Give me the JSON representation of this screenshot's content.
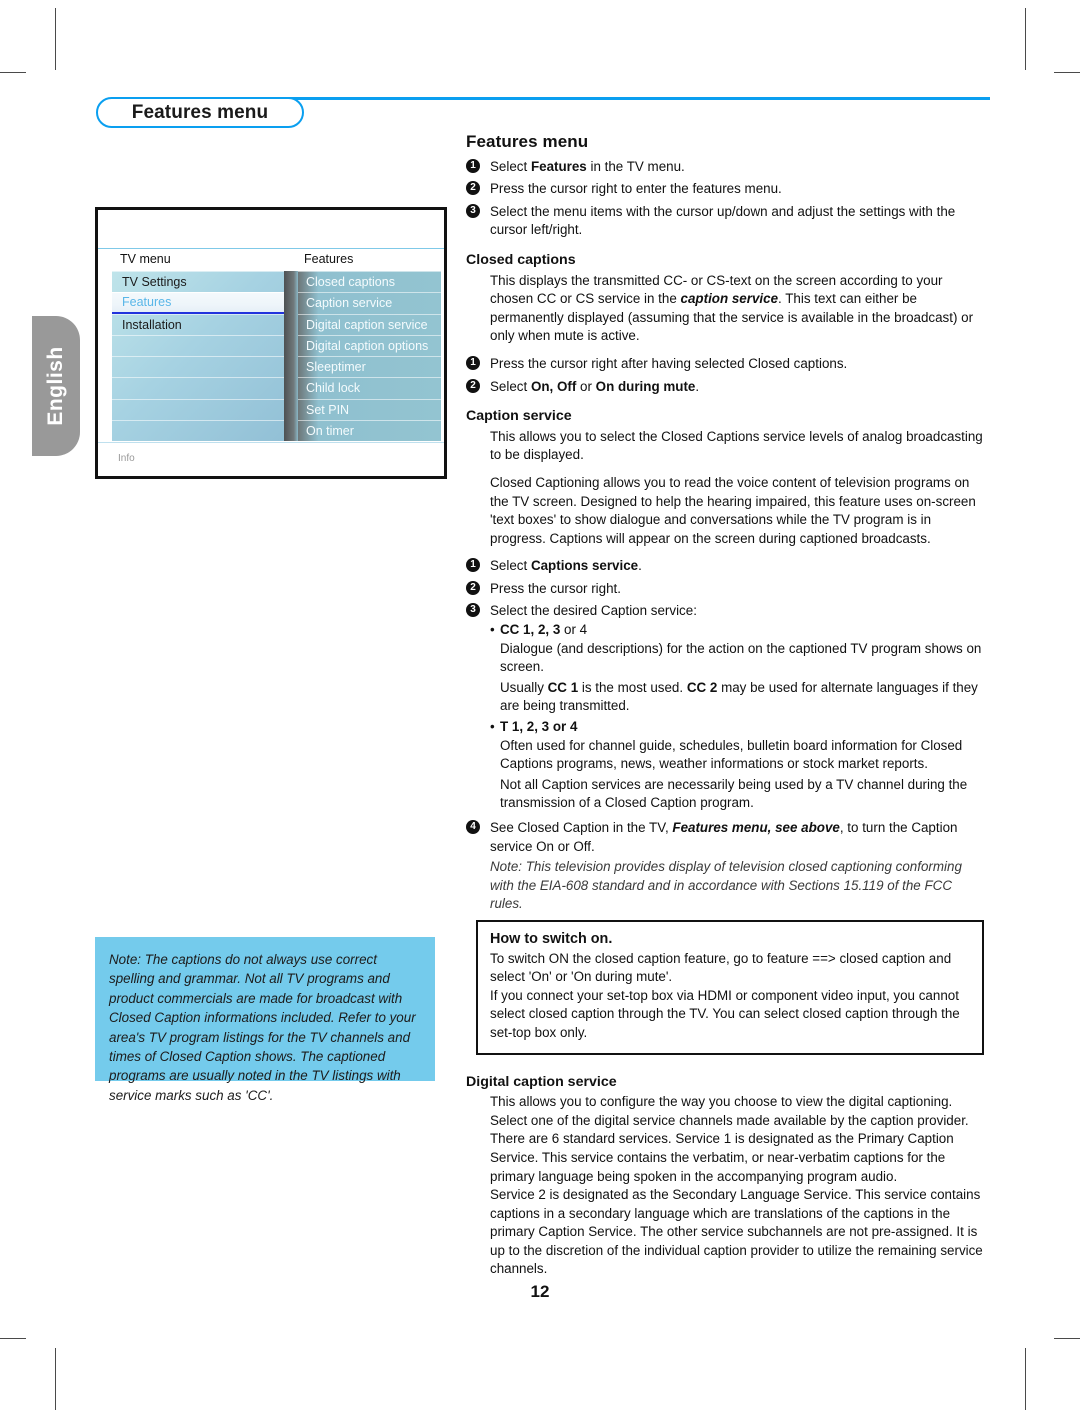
{
  "page": {
    "number": "12",
    "language_tab": "English",
    "header_badge": "Features menu"
  },
  "figure": {
    "col_head_left": "TV menu",
    "col_head_right": "Features",
    "info_label": "Info",
    "left_items": [
      {
        "label": "TV Settings",
        "selected": false
      },
      {
        "label": "Features",
        "selected": true
      },
      {
        "label": "Installation",
        "selected": false
      },
      {
        "label": "",
        "selected": false
      },
      {
        "label": "",
        "selected": false
      },
      {
        "label": "",
        "selected": false
      },
      {
        "label": "",
        "selected": false
      },
      {
        "label": "",
        "selected": false
      }
    ],
    "right_items": [
      {
        "label": "Closed captions"
      },
      {
        "label": "Caption service"
      },
      {
        "label": "Digital caption service"
      },
      {
        "label": "Digital caption options"
      },
      {
        "label": "Sleeptimer"
      },
      {
        "label": "Child lock"
      },
      {
        "label": "Set PIN"
      },
      {
        "label": "On timer"
      }
    ]
  },
  "note_box": {
    "text": "Note: The captions do not always use correct spelling and grammar. Not all TV programs and product commercials are made for broadcast with Closed Caption informations included. Refer to your area's TV program listings for the TV channels and times of Closed Caption shows. The captioned programs are usually noted in the TV listings with service marks such as 'CC'."
  },
  "content": {
    "section_title": "Features menu",
    "steps_intro": [
      {
        "num": "1",
        "text_parts": [
          "Select ",
          "Features",
          " in the TV menu."
        ]
      },
      {
        "num": "2",
        "text_parts": [
          "Press the cursor right to enter the features menu.",
          "",
          ""
        ]
      },
      {
        "num": "3",
        "text_parts": [
          "Select the menu items with the cursor up/down and adjust the settings with the cursor left/right.",
          "",
          ""
        ]
      }
    ],
    "step1_pre": "Select ",
    "step1_bold": "Features",
    "step1_post": " in the TV menu.",
    "step2": "Press the cursor right to enter the features menu.",
    "step3": "Select the menu items with the cursor up/down and adjust the settings with the cursor left/right.",
    "closed_captions": {
      "title": "Closed captions",
      "body_pre": "This displays the transmitted CC- or CS-text on the screen according to your chosen CC or CS service in the ",
      "body_bolditalic": "caption service",
      "body_post": ". This text can either be permanently displayed (assuming that the service is available in the broadcast) or only when mute is active.",
      "step1": "Press the cursor right after having selected Closed captions.",
      "step2_pre": "Select ",
      "step2_bold_a": "On, Off",
      "step2_mid": " or ",
      "step2_bold_b": "On during mute",
      "step2_post": "."
    },
    "caption_service": {
      "title": "Caption service",
      "para1": "This allows you to select the Closed Captions service levels of analog broadcasting to be displayed.",
      "para2": "Closed Captioning allows you to read the voice content of television programs on the TV screen. Designed to help the hearing impaired, this feature uses on-screen 'text boxes' to show dialogue and conversations while the TV program is in progress. Captions will appear on the screen during captioned broadcasts.",
      "step1_pre": "Select ",
      "step1_bold": "Captions service",
      "step1_post": ".",
      "step2": "Press the cursor right.",
      "step3": "Select the desired Caption service:",
      "bullet_dot": "•",
      "cc_bullet_bold": "CC 1, 2, 3",
      "cc_bullet_rest": " or 4",
      "cc_body_1": "Dialogue (and descriptions) for the action on the captioned TV program shows on screen.",
      "cc_body_2_pre": "Usually ",
      "cc_body_2_bold_a": "CC 1",
      "cc_body_2_mid": " is the most used. ",
      "cc_body_2_bold_b": "CC 2",
      "cc_body_2_post": " may be used for alternate languages if they are being transmitted.",
      "t_bullet_bold": "T 1, 2, 3 or 4",
      "t_body_1": "Often used for channel guide, schedules, bulletin board information for Closed Captions programs, news, weather informations or stock market reports.",
      "t_body_2": "Not all Caption services are necessarily being used by a TV channel during the transmission of a Closed Caption program.",
      "step4_pre": "See Closed Caption in the TV, ",
      "step4_bolditalic": "Features menu, see above",
      "step4_post": ", to turn the Caption service On or Off.",
      "note": "Note: This television provides display of television closed captioning conforming with the EIA-608 standard and in accordance with Sections 15.119 of the FCC rules."
    },
    "howto_box": {
      "title": "How to switch on.",
      "para1": "To switch ON the closed caption feature, go to feature ==> closed caption and select 'On' or 'On during mute'.",
      "para2": "If you connect your set-top box via HDMI or component video input, you cannot select closed caption through the TV. You can select closed caption through the set-top box only."
    },
    "digital_caption_service": {
      "title": "Digital caption service",
      "body": "This allows you to configure the way you choose to view the digital captioning. Select one of the digital service channels made available by the caption provider. There are 6 standard services. Service 1 is designated as the Primary Caption Service. This service contains the verbatim, or near-verbatim captions for the primary language being spoken in the accompanying program audio.\nService 2 is designated as the Secondary Language Service. This service contains captions in a secondary language which are translations of the captions in the primary Caption Service. The other service subchannels are not pre-assigned. It is up to the discretion of the individual caption provider to utilize the remaining service channels.",
      "body_line_a": "This allows you to configure the way you choose to view the digital captioning. Select one of the digital service channels made available by the caption provider. There are 6 standard services. Service 1 is designated as the Primary Caption Service. This service contains the verbatim, or near-verbatim captions for the primary language being spoken in the accompanying program audio.",
      "body_line_b": "Service 2 is designated as the Secondary Language Service. This service contains captions in a secondary language which are translations of the captions in the primary Caption Service. The other service subchannels are not pre-assigned. It is up to the discretion of the individual caption provider to utilize the remaining service channels."
    }
  },
  "colors": {
    "accent_blue": "#0a9ff0",
    "note_box_blue": "#74cbec",
    "tab_gray": "#999999",
    "menu_highlight_text": "#59b6e8"
  }
}
